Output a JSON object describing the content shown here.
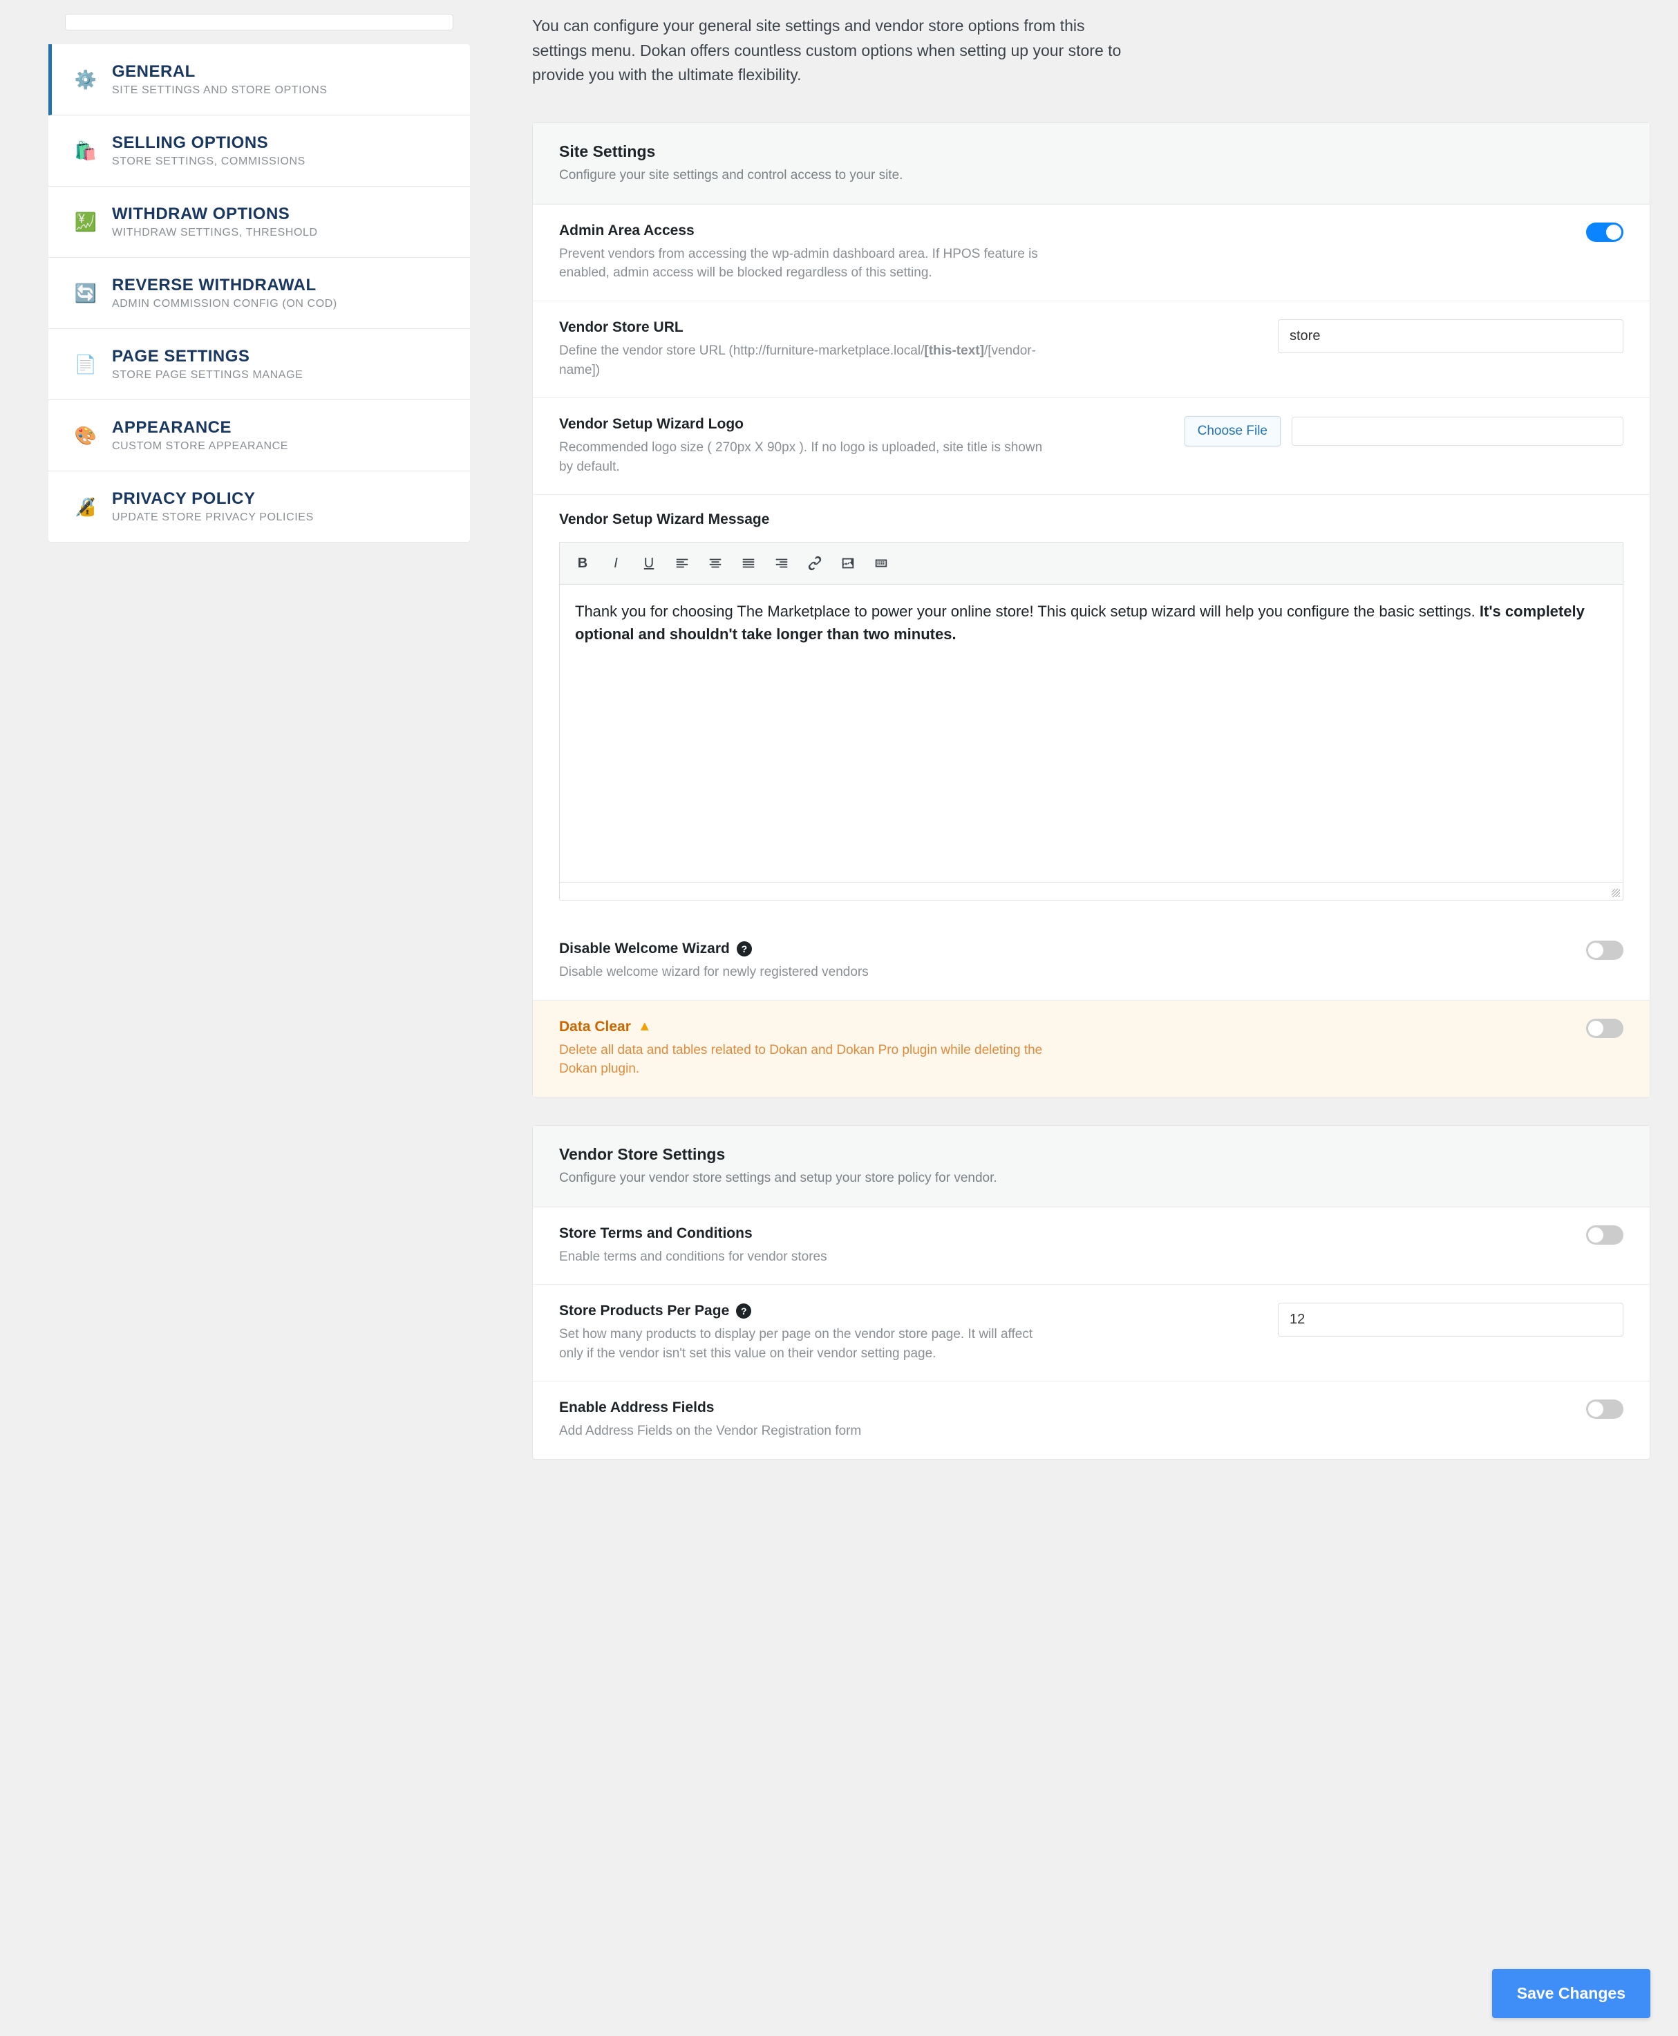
{
  "intro": "You can configure your general site settings and vendor store options from this settings menu. Dokan offers countless custom options when setting up your store to provide you with the ultimate flexibility.",
  "sidebar": {
    "items": [
      {
        "title": "GENERAL",
        "sub": "SITE SETTINGS AND STORE OPTIONS",
        "icon": "⚙️",
        "active": true
      },
      {
        "title": "SELLING OPTIONS",
        "sub": "STORE SETTINGS, COMMISSIONS",
        "icon": "🛍️",
        "active": false
      },
      {
        "title": "WITHDRAW OPTIONS",
        "sub": "WITHDRAW SETTINGS, THRESHOLD",
        "icon": "💹",
        "active": false
      },
      {
        "title": "REVERSE WITHDRAWAL",
        "sub": "ADMIN COMMISSION CONFIG (ON COD)",
        "icon": "🔄",
        "active": false
      },
      {
        "title": "PAGE SETTINGS",
        "sub": "STORE PAGE SETTINGS MANAGE",
        "icon": "📄",
        "active": false
      },
      {
        "title": "APPEARANCE",
        "sub": "CUSTOM STORE APPEARANCE",
        "icon": "🎨",
        "active": false
      },
      {
        "title": "PRIVACY POLICY",
        "sub": "UPDATE STORE PRIVACY POLICIES",
        "icon": "🔏",
        "active": false
      }
    ]
  },
  "site_settings": {
    "header_title": "Site Settings",
    "header_sub": "Configure your site settings and control access to your site.",
    "admin_access": {
      "title": "Admin Area Access",
      "desc": "Prevent vendors from accessing the wp-admin dashboard area. If HPOS feature is enabled, admin access will be blocked regardless of this setting.",
      "on": true
    },
    "store_url": {
      "title": "Vendor Store URL",
      "desc_pre": "Define the vendor store URL (http://furniture-marketplace.local/",
      "desc_bold": "[this-text]",
      "desc_post": "/[vendor-name])",
      "value": "store"
    },
    "wizard_logo": {
      "title": "Vendor Setup Wizard Logo",
      "desc": "Recommended logo size ( 270px X 90px ). If no logo is uploaded, site title is shown by default.",
      "button": "Choose File"
    },
    "wizard_message": {
      "title": "Vendor Setup Wizard Message",
      "body_plain": "Thank you for choosing The Marketplace to power your online store! This quick setup wizard will help you configure the basic settings. ",
      "body_bold": "It's completely optional and shouldn't take longer than two minutes."
    },
    "disable_wizard": {
      "title": "Disable Welcome Wizard",
      "desc": "Disable welcome wizard for newly registered vendors",
      "on": false
    },
    "data_clear": {
      "title": "Data Clear",
      "desc": "Delete all data and tables related to Dokan and Dokan Pro plugin while deleting the Dokan plugin.",
      "on": false
    }
  },
  "vendor_settings": {
    "header_title": "Vendor Store Settings",
    "header_sub": "Configure your vendor store settings and setup your store policy for vendor.",
    "terms": {
      "title": "Store Terms and Conditions",
      "desc": "Enable terms and conditions for vendor stores",
      "on": false
    },
    "per_page": {
      "title": "Store Products Per Page",
      "desc": "Set how many products to display per page on the vendor store page. It will affect only if the vendor isn't set this value on their vendor setting page.",
      "value": "12"
    },
    "address": {
      "title": "Enable Address Fields",
      "desc": "Add Address Fields on the Vendor Registration form",
      "on": false
    }
  },
  "save_label": "Save Changes",
  "help_glyph": "?",
  "warn_glyph": "▲"
}
